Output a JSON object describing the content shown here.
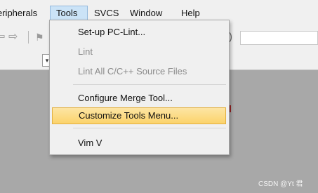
{
  "menubar": {
    "items": [
      "eripherals",
      "Tools",
      "SVCS",
      "Window",
      "Help"
    ]
  },
  "toolbar": {
    "icons": [
      "back-arrow-icon",
      "forward-arrow-icon",
      "flag-icon"
    ],
    "partial_text": ")"
  },
  "tools_menu": {
    "items": [
      {
        "label": "Set-up PC-Lint...",
        "enabled": true
      },
      {
        "label": "Lint",
        "enabled": false
      },
      {
        "label": "Lint All C/C++ Source Files",
        "enabled": false
      },
      {
        "label": "Configure Merge Tool...",
        "enabled": true
      },
      {
        "label": "Customize Tools Menu...",
        "enabled": true,
        "highlighted": true
      },
      {
        "label": "Vim V",
        "enabled": true
      }
    ]
  },
  "watermark": "CSDN @Yt 君",
  "colors": {
    "menu_open_bg": "#cbe3f7",
    "highlight_bg": "#fbd36b",
    "disabled_text": "#8b8b8b",
    "editor_bg": "#a8a8a8"
  }
}
